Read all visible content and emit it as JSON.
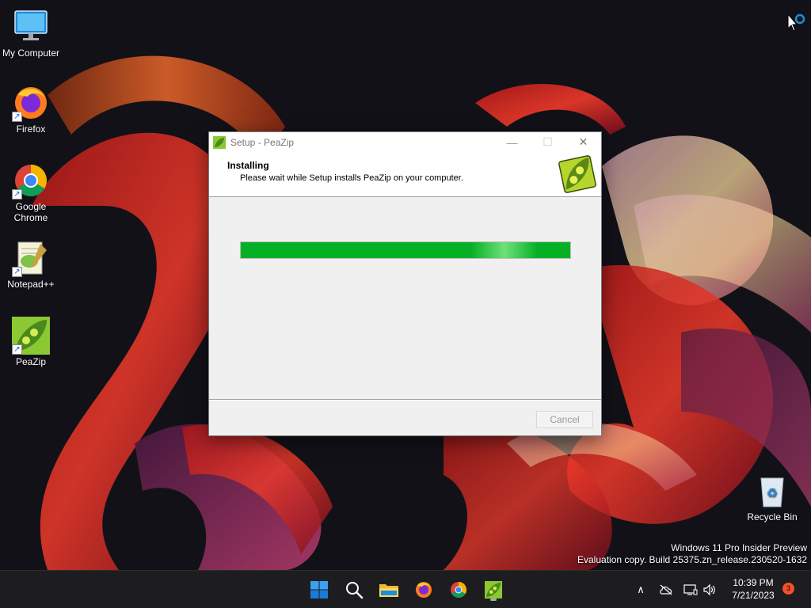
{
  "desktop": {
    "icons": [
      {
        "label": "My Computer"
      },
      {
        "label": "Firefox"
      },
      {
        "label": "Google Chrome"
      },
      {
        "label": "Notepad++"
      },
      {
        "label": "PeaZip"
      },
      {
        "label": "Recycle Bin"
      }
    ],
    "watermark": {
      "line1": "Windows 11 Pro Insider Preview",
      "line2": "Evaluation copy. Build 25375.zn_release.230520-1632"
    }
  },
  "dialog": {
    "title": "Setup - PeaZip",
    "heading": "Installing",
    "subheading": "Please wait while Setup installs PeaZip on your computer.",
    "progress_fraction": 1.0,
    "cancel_label": "Cancel",
    "minimize_glyph": "—",
    "maximize_glyph": "☐",
    "close_glyph": "✕"
  },
  "taskbar": {
    "apps": [
      "start-icon",
      "search-icon",
      "file-explorer-icon",
      "firefox-icon",
      "chrome-icon",
      "peazip-icon"
    ],
    "time": "10:39 PM",
    "date": "7/21/2023",
    "notification_count": "3",
    "tray_chevron": "∧"
  },
  "colors": {
    "progress": "#06b025",
    "taskbar": "#1d1d1f",
    "accent_blue": "#1a8fe0"
  }
}
